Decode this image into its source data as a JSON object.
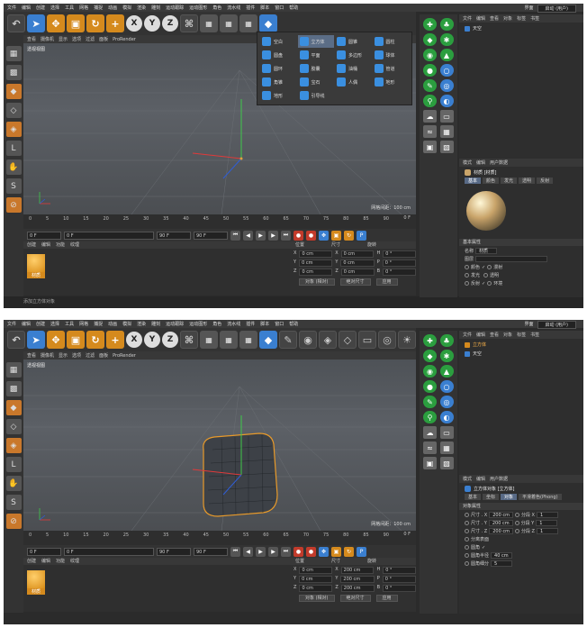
{
  "menu": {
    "items": [
      "文件",
      "编辑",
      "创建",
      "选择",
      "工具",
      "网格",
      "捕捉",
      "动画",
      "模拟",
      "渲染",
      "雕刻",
      "运动跟踪",
      "运动图形",
      "角色",
      "流水线",
      "插件",
      "脚本",
      "窗口",
      "帮助"
    ],
    "layout_label": "界面",
    "layout_value": "启动 (用户)"
  },
  "viewport": {
    "menu": [
      "查看",
      "摄像机",
      "显示",
      "选项",
      "过滤",
      "面板",
      "ProRender"
    ],
    "label": "透视视图",
    "grid_info": "网格间距：100 cm"
  },
  "timeline": {
    "ticks": [
      "0",
      "5",
      "10",
      "15",
      "20",
      "25",
      "30",
      "35",
      "40",
      "45",
      "50",
      "55",
      "60",
      "65",
      "70",
      "75",
      "80",
      "85",
      "90"
    ],
    "current_frame": "0 F",
    "start_frame": "0 F",
    "end_frame": "90 F",
    "end_frame2": "90 F",
    "frame_end_label": "0 F"
  },
  "material": {
    "menu": [
      "创建",
      "编辑",
      "功能",
      "纹理"
    ],
    "name": "材质"
  },
  "status": "添加立方体对象",
  "dropdown": {
    "items": [
      {
        "label": "空白"
      },
      {
        "label": "立方体"
      },
      {
        "label": "圆锥"
      },
      {
        "label": "圆柱"
      },
      {
        "label": "圆盘"
      },
      {
        "label": "平面"
      },
      {
        "label": "多边形"
      },
      {
        "label": "球体"
      },
      {
        "label": "圆环"
      },
      {
        "label": "胶囊"
      },
      {
        "label": "油桶"
      },
      {
        "label": "管道"
      },
      {
        "label": "角锥"
      },
      {
        "label": "宝石"
      },
      {
        "label": "人偶"
      },
      {
        "label": "地形"
      },
      {
        "label": "地形"
      },
      {
        "label": "引导线"
      }
    ]
  },
  "screen1": {
    "objects": {
      "menu": [
        "文件",
        "编辑",
        "查看",
        "对象",
        "标签",
        "书签"
      ],
      "rows": [
        {
          "name": "天空",
          "selected": false
        }
      ]
    },
    "attr": {
      "menu": [
        "模式",
        "编辑",
        "用户数据"
      ],
      "title": "材质 [材质]",
      "tabs": [
        "基本",
        "颜色",
        "发光",
        "透明",
        "反射"
      ],
      "section": "基本属性",
      "name_label": "名称",
      "name_value": "材质",
      "layer_label": "图层",
      "channels": [
        [
          "颜色",
          "✓"
        ],
        [
          "漫射",
          ""
        ],
        [
          "发光",
          ""
        ],
        [
          "透明",
          ""
        ],
        [
          "反射",
          "✓"
        ],
        [
          "环境",
          ""
        ]
      ]
    },
    "coords": {
      "headers": [
        "位置",
        "尺寸",
        "旋转"
      ],
      "rows": [
        [
          "X",
          "0 cm",
          "X",
          "0 cm",
          "H",
          "0 °"
        ],
        [
          "Y",
          "0 cm",
          "Y",
          "0 cm",
          "P",
          "0 °"
        ],
        [
          "Z",
          "0 cm",
          "Z",
          "0 cm",
          "B",
          "0 °"
        ]
      ],
      "mode": "对象 (相对)",
      "size_mode": "绝对尺寸",
      "apply": "应用"
    }
  },
  "screen2": {
    "objects": {
      "menu": [
        "文件",
        "编辑",
        "查看",
        "对象",
        "标签",
        "书签"
      ],
      "rows": [
        {
          "name": "立方体",
          "selected": true
        },
        {
          "name": "天空",
          "selected": false
        }
      ]
    },
    "attr": {
      "menu": [
        "模式",
        "编辑",
        "用户数据"
      ],
      "title": "立方体对象 [立方体]",
      "tabs": [
        "基本",
        "坐标",
        "对象",
        "平滑着色(Phong)"
      ],
      "section": "对象属性",
      "rows": [
        [
          "尺寸 . X",
          "200 cm",
          "分段 X",
          "1"
        ],
        [
          "尺寸 . Y",
          "200 cm",
          "分段 Y",
          "1"
        ],
        [
          "尺寸 . Z",
          "200 cm",
          "分段 Z",
          "1"
        ]
      ],
      "sep_label": "分离表面",
      "fillet_label": "圆角",
      "fillet_radius_label": "圆角半径",
      "fillet_radius": "40 cm",
      "fillet_sub_label": "圆角细分",
      "fillet_sub": "5"
    },
    "coords": {
      "headers": [
        "位置",
        "尺寸",
        "旋转"
      ],
      "rows": [
        [
          "X",
          "0 cm",
          "X",
          "200 cm",
          "H",
          "0 °"
        ],
        [
          "Y",
          "0 cm",
          "Y",
          "200 cm",
          "P",
          "0 °"
        ],
        [
          "Z",
          "0 cm",
          "Z",
          "200 cm",
          "B",
          "0 °"
        ]
      ],
      "mode": "对象 (相对)",
      "size_mode": "绝对尺寸",
      "apply": "应用"
    }
  }
}
